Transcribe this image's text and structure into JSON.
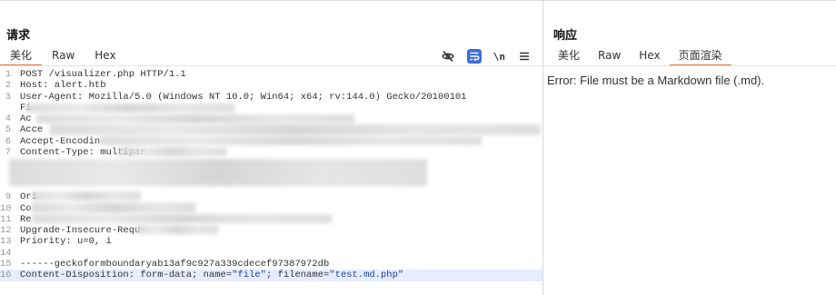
{
  "request": {
    "title": "请求",
    "tabs": [
      {
        "label": "美化"
      },
      {
        "label": "Raw"
      },
      {
        "label": "Hex"
      }
    ],
    "tools": {
      "newline_label": "\\n"
    },
    "lines": [
      {
        "n": "1",
        "text": "POST /visualizer.php HTTP/1.1"
      },
      {
        "n": "2",
        "text": "Host: alert.htb"
      },
      {
        "n": "3",
        "text": "User-Agent: Mozilla/5.0 (Windows NT 10.0; Win64; x64; rv:144.0) Gecko/20100101"
      },
      {
        "n": "",
        "text": "Fi"
      },
      {
        "n": "4",
        "text": "Ac"
      },
      {
        "n": "5",
        "text": "Acce"
      },
      {
        "n": "6",
        "text": "Accept-Encodin"
      },
      {
        "n": "7",
        "text": "Content-Type: multipar"
      },
      {
        "n": "",
        "text": ""
      },
      {
        "n": "",
        "text": ""
      },
      {
        "n": "",
        "text": ""
      },
      {
        "n": "9",
        "text": "Ori"
      },
      {
        "n": "10",
        "text": "Co"
      },
      {
        "n": "11",
        "text": "Re"
      },
      {
        "n": "12",
        "text": "Upgrade-Insecure-Requ"
      },
      {
        "n": "13",
        "text": "Priority: u=0, i"
      },
      {
        "n": "14",
        "text": ""
      },
      {
        "n": "15",
        "text": "------geckoformboundaryab13af9c927a339cdecef97387972db"
      },
      {
        "n": "16",
        "text": "Content-Disposition: form-data; name=\"file\"; filename=\"test.md.php\""
      }
    ]
  },
  "response": {
    "title": "响应",
    "tabs": [
      {
        "label": "美化"
      },
      {
        "label": "Raw"
      },
      {
        "label": "Hex"
      },
      {
        "label": "页面渲染"
      }
    ],
    "body_text": "Error: File must be a Markdown file (.md)."
  },
  "colors": {
    "accent": "#e8743b",
    "wrap_button": "#3d6fd6"
  }
}
